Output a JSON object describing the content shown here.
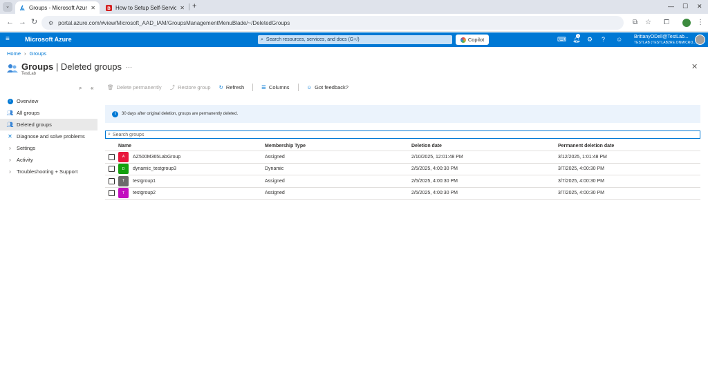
{
  "browser": {
    "tabs": [
      {
        "title": "Groups - Microsoft Azure",
        "active": true
      },
      {
        "title": "How to Setup Self-Servic",
        "active": false
      }
    ],
    "url": "portal.azure.com/#view/Microsoft_AAD_IAM/GroupsManagementMenuBlade/~/DeletedGroups"
  },
  "azure_header": {
    "brand": "Microsoft Azure",
    "search_placeholder": "Search resources, services, and docs (G+/)",
    "copilot_label": "Copilot",
    "notification_count": "1",
    "user_name": "BrittanyODell@TestLab...",
    "user_tenant": "TESTLAB (TESTLAB2RE.ONMICRO..."
  },
  "breadcrumb": [
    "Home",
    "Groups"
  ],
  "page": {
    "title_main": "Groups",
    "title_sep": " | ",
    "title_sub": "Deleted groups",
    "more": "···",
    "subtitle": "TestLab"
  },
  "left_nav": [
    {
      "label": "Overview",
      "icon": "info-icon",
      "selected": false,
      "expandable": false
    },
    {
      "label": "All groups",
      "icon": "group-icon",
      "selected": false,
      "expandable": false
    },
    {
      "label": "Deleted groups",
      "icon": "group-icon",
      "selected": true,
      "expandable": false
    },
    {
      "label": "Diagnose and solve problems",
      "icon": "wrench-icon",
      "selected": false,
      "expandable": false
    },
    {
      "label": "Settings",
      "icon": "chevron-right-icon",
      "selected": false,
      "expandable": true
    },
    {
      "label": "Activity",
      "icon": "chevron-right-icon",
      "selected": false,
      "expandable": true
    },
    {
      "label": "Troubleshooting + Support",
      "icon": "chevron-right-icon",
      "selected": false,
      "expandable": true
    }
  ],
  "commands": {
    "delete_permanently": "Delete permanently",
    "restore_group": "Restore group",
    "refresh": "Refresh",
    "columns": "Columns",
    "feedback": "Got feedback?"
  },
  "banner": {
    "text": "30 days after original deletion, groups are permanently deleted."
  },
  "search": {
    "placeholder": "Search groups"
  },
  "table": {
    "columns": [
      "Name",
      "Membership Type",
      "Deletion date",
      "Permanent deletion date"
    ],
    "rows": [
      {
        "initial": "A",
        "color": "#e8173c",
        "name": "AZ500M365LabGroup",
        "type": "Assigned",
        "deleted": "2/10/2025, 12:01:48 PM",
        "permanent": "3/12/2025, 1:01:48 PM"
      },
      {
        "initial": "D",
        "color": "#13a10e",
        "name": "dynamic_testgroup3",
        "type": "Dynamic",
        "deleted": "2/5/2025, 4:00:30 PM",
        "permanent": "3/7/2025, 4:00:30 PM"
      },
      {
        "initial": "T",
        "color": "#6b6b6b",
        "name": "testgroup1",
        "type": "Assigned",
        "deleted": "2/5/2025, 4:00:30 PM",
        "permanent": "3/7/2025, 4:00:30 PM"
      },
      {
        "initial": "T",
        "color": "#c30fbf",
        "name": "testgroup2",
        "type": "Assigned",
        "deleted": "2/5/2025, 4:00:30 PM",
        "permanent": "3/7/2025, 4:00:30 PM"
      }
    ]
  }
}
